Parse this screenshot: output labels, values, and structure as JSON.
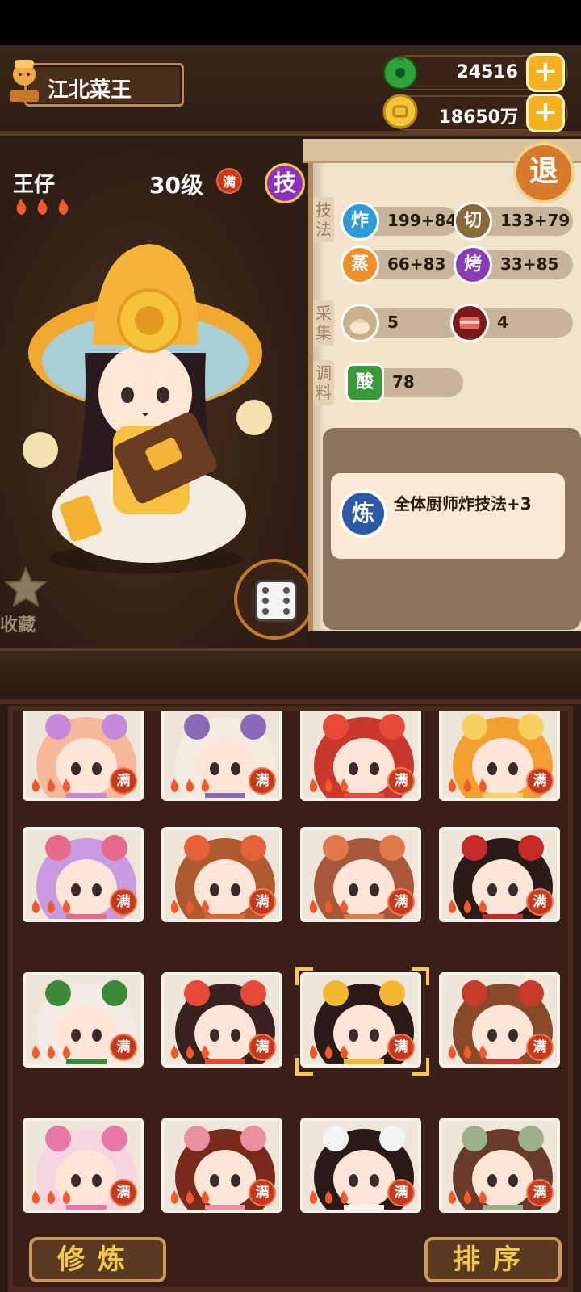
{
  "header": {
    "title": "江北菜王",
    "jade_amount": "24516",
    "coin_amount": "18650万",
    "plus_label": "+"
  },
  "chef": {
    "name": "王仔",
    "level": "30级",
    "full_label": "满",
    "skill_label": "技",
    "favorite_label": "收藏"
  },
  "stats": {
    "exit_label": "退",
    "skills_section": "技法",
    "gather_section": "采集",
    "seasoning_section": "调料",
    "skills": [
      {
        "icon": "炸",
        "value": "199+84",
        "color": "#2f9ad8"
      },
      {
        "icon": "切",
        "value": "133+79",
        "color": "#8a6a3a"
      },
      {
        "icon": "蒸",
        "value": "66+83",
        "color": "#f0902a"
      },
      {
        "icon": "烤",
        "value": "33+85",
        "color": "#8a3cb8"
      }
    ],
    "gather": [
      {
        "icon": "flour-sack-icon",
        "value": "5"
      },
      {
        "icon": "meat-icon",
        "value": "4"
      }
    ],
    "seasoning": [
      {
        "icon": "酸",
        "value": "78",
        "color": "#3a9a3a"
      }
    ]
  },
  "effect": {
    "icon": "炼",
    "text": "全体厨师炸技法+3"
  },
  "grid": {
    "full_label": "满",
    "cards": [
      {
        "hair": "#f6b89a",
        "accent": "#c888d8"
      },
      {
        "hair": "#f4ece0",
        "accent": "#8a6ab8"
      },
      {
        "hair": "#c8382c",
        "accent": "#e84a3a"
      },
      {
        "hair": "#f4a030",
        "accent": "#f8d060"
      },
      {
        "hair": "#c89ae0",
        "accent": "#e86a8a"
      },
      {
        "hair": "#b05a30",
        "accent": "#e8603a"
      },
      {
        "hair": "#a8583a",
        "accent": "#e07a4a"
      },
      {
        "hair": "#2a1a18",
        "accent": "#c82a2a"
      },
      {
        "hair": "#f4ece4",
        "accent": "#3a8a3a"
      },
      {
        "hair": "#3a2220",
        "accent": "#e84a3a"
      },
      {
        "hair": "#2a1a18",
        "accent": "#f4b830"
      },
      {
        "hair": "#8a4a2a",
        "accent": "#c83a2a"
      },
      {
        "hair": "#f6d4e0",
        "accent": "#e878a8"
      },
      {
        "hair": "#7a2a1a",
        "accent": "#e890a0"
      },
      {
        "hair": "#2a1a18",
        "accent": "#f4f4f4"
      },
      {
        "hair": "#6a3a2a",
        "accent": "#9ab08a"
      }
    ]
  },
  "buttons": {
    "cultivate_label": "修炼",
    "sort_label": "排序"
  }
}
